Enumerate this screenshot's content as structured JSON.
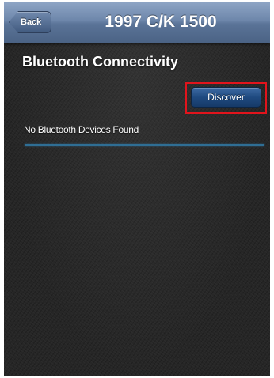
{
  "navbar": {
    "back_label": "Back",
    "title": "1997 C/K 1500"
  },
  "section": {
    "title": "Bluetooth Connectivity"
  },
  "actions": {
    "discover_label": "Discover"
  },
  "status": {
    "message": "No Bluetooth Devices Found"
  },
  "colors": {
    "navbar": "#6e87ab",
    "background": "#262626",
    "discover_button": "#1f4a80",
    "highlight": "#e1141c",
    "divider": "#2f6e94"
  }
}
